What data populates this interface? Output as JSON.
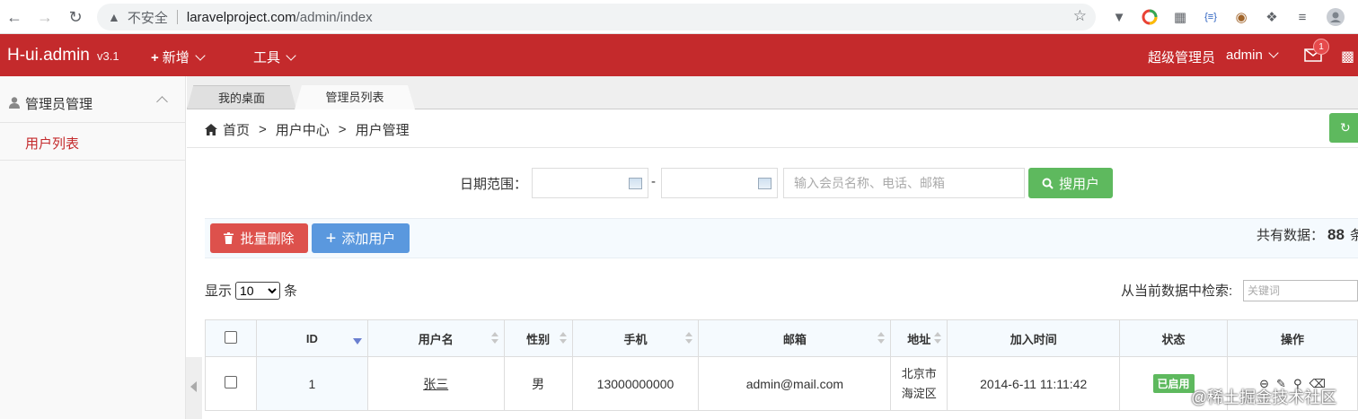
{
  "browser": {
    "insecure_label": "不安全",
    "url_host": "laravelproject.com",
    "url_path": "/admin/index"
  },
  "header": {
    "brand": "H-ui.admin",
    "version": "v3.1",
    "menu_new": "新增",
    "menu_tools": "工具",
    "role": "超级管理员",
    "user": "admin",
    "mail_count": "1",
    "brand_color": "#c42a2c"
  },
  "sidebar": {
    "group_label": "管理员管理",
    "items": [
      {
        "label": "用户列表"
      }
    ]
  },
  "tabs": [
    {
      "label": "我的桌面"
    },
    {
      "label": "管理员列表"
    }
  ],
  "breadcrumb": {
    "home": "首页",
    "sep": ">",
    "level1": "用户中心",
    "level2": "用户管理"
  },
  "search": {
    "date_label": "日期范围：",
    "dash": "-",
    "keyword_placeholder": "输入会员名称、电话、邮箱",
    "button_label": "搜用户"
  },
  "actions": {
    "batch_delete": "批量删除",
    "add_user": "添加用户",
    "total_prefix": "共有数据：",
    "total_count": "88",
    "total_suffix": "条"
  },
  "list": {
    "show_label": "显示",
    "page_size": "10",
    "page_size_options": [
      "10"
    ],
    "unit_label": "条",
    "filter_label": "从当前数据中检索:",
    "filter_placeholder": "关键词"
  },
  "table": {
    "columns": [
      "ID",
      "用户名",
      "性别",
      "手机",
      "邮箱",
      "地址",
      "加入时间",
      "状态",
      "操作"
    ],
    "rows": [
      {
        "id": "1",
        "username": "张三",
        "gender": "男",
        "phone": "13000000000",
        "email": "admin@mail.com",
        "address_line1": "北京市",
        "address_line2": "海淀区",
        "join_time": "2014-6-11 11:11:42",
        "status": "已启用"
      }
    ]
  },
  "watermark": "@稀土掘金技术社区"
}
